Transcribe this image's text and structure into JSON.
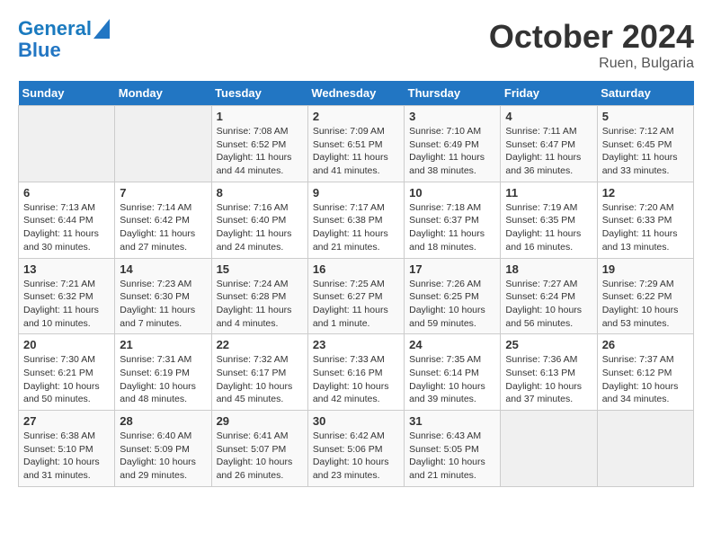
{
  "header": {
    "logo_line1": "General",
    "logo_line2": "Blue",
    "month": "October 2024",
    "location": "Ruen, Bulgaria"
  },
  "weekdays": [
    "Sunday",
    "Monday",
    "Tuesday",
    "Wednesday",
    "Thursday",
    "Friday",
    "Saturday"
  ],
  "weeks": [
    [
      {
        "day": "",
        "info": ""
      },
      {
        "day": "",
        "info": ""
      },
      {
        "day": "1",
        "info": "Sunrise: 7:08 AM\nSunset: 6:52 PM\nDaylight: 11 hours and 44 minutes."
      },
      {
        "day": "2",
        "info": "Sunrise: 7:09 AM\nSunset: 6:51 PM\nDaylight: 11 hours and 41 minutes."
      },
      {
        "day": "3",
        "info": "Sunrise: 7:10 AM\nSunset: 6:49 PM\nDaylight: 11 hours and 38 minutes."
      },
      {
        "day": "4",
        "info": "Sunrise: 7:11 AM\nSunset: 6:47 PM\nDaylight: 11 hours and 36 minutes."
      },
      {
        "day": "5",
        "info": "Sunrise: 7:12 AM\nSunset: 6:45 PM\nDaylight: 11 hours and 33 minutes."
      }
    ],
    [
      {
        "day": "6",
        "info": "Sunrise: 7:13 AM\nSunset: 6:44 PM\nDaylight: 11 hours and 30 minutes."
      },
      {
        "day": "7",
        "info": "Sunrise: 7:14 AM\nSunset: 6:42 PM\nDaylight: 11 hours and 27 minutes."
      },
      {
        "day": "8",
        "info": "Sunrise: 7:16 AM\nSunset: 6:40 PM\nDaylight: 11 hours and 24 minutes."
      },
      {
        "day": "9",
        "info": "Sunrise: 7:17 AM\nSunset: 6:38 PM\nDaylight: 11 hours and 21 minutes."
      },
      {
        "day": "10",
        "info": "Sunrise: 7:18 AM\nSunset: 6:37 PM\nDaylight: 11 hours and 18 minutes."
      },
      {
        "day": "11",
        "info": "Sunrise: 7:19 AM\nSunset: 6:35 PM\nDaylight: 11 hours and 16 minutes."
      },
      {
        "day": "12",
        "info": "Sunrise: 7:20 AM\nSunset: 6:33 PM\nDaylight: 11 hours and 13 minutes."
      }
    ],
    [
      {
        "day": "13",
        "info": "Sunrise: 7:21 AM\nSunset: 6:32 PM\nDaylight: 11 hours and 10 minutes."
      },
      {
        "day": "14",
        "info": "Sunrise: 7:23 AM\nSunset: 6:30 PM\nDaylight: 11 hours and 7 minutes."
      },
      {
        "day": "15",
        "info": "Sunrise: 7:24 AM\nSunset: 6:28 PM\nDaylight: 11 hours and 4 minutes."
      },
      {
        "day": "16",
        "info": "Sunrise: 7:25 AM\nSunset: 6:27 PM\nDaylight: 11 hours and 1 minute."
      },
      {
        "day": "17",
        "info": "Sunrise: 7:26 AM\nSunset: 6:25 PM\nDaylight: 10 hours and 59 minutes."
      },
      {
        "day": "18",
        "info": "Sunrise: 7:27 AM\nSunset: 6:24 PM\nDaylight: 10 hours and 56 minutes."
      },
      {
        "day": "19",
        "info": "Sunrise: 7:29 AM\nSunset: 6:22 PM\nDaylight: 10 hours and 53 minutes."
      }
    ],
    [
      {
        "day": "20",
        "info": "Sunrise: 7:30 AM\nSunset: 6:21 PM\nDaylight: 10 hours and 50 minutes."
      },
      {
        "day": "21",
        "info": "Sunrise: 7:31 AM\nSunset: 6:19 PM\nDaylight: 10 hours and 48 minutes."
      },
      {
        "day": "22",
        "info": "Sunrise: 7:32 AM\nSunset: 6:17 PM\nDaylight: 10 hours and 45 minutes."
      },
      {
        "day": "23",
        "info": "Sunrise: 7:33 AM\nSunset: 6:16 PM\nDaylight: 10 hours and 42 minutes."
      },
      {
        "day": "24",
        "info": "Sunrise: 7:35 AM\nSunset: 6:14 PM\nDaylight: 10 hours and 39 minutes."
      },
      {
        "day": "25",
        "info": "Sunrise: 7:36 AM\nSunset: 6:13 PM\nDaylight: 10 hours and 37 minutes."
      },
      {
        "day": "26",
        "info": "Sunrise: 7:37 AM\nSunset: 6:12 PM\nDaylight: 10 hours and 34 minutes."
      }
    ],
    [
      {
        "day": "27",
        "info": "Sunrise: 6:38 AM\nSunset: 5:10 PM\nDaylight: 10 hours and 31 minutes."
      },
      {
        "day": "28",
        "info": "Sunrise: 6:40 AM\nSunset: 5:09 PM\nDaylight: 10 hours and 29 minutes."
      },
      {
        "day": "29",
        "info": "Sunrise: 6:41 AM\nSunset: 5:07 PM\nDaylight: 10 hours and 26 minutes."
      },
      {
        "day": "30",
        "info": "Sunrise: 6:42 AM\nSunset: 5:06 PM\nDaylight: 10 hours and 23 minutes."
      },
      {
        "day": "31",
        "info": "Sunrise: 6:43 AM\nSunset: 5:05 PM\nDaylight: 10 hours and 21 minutes."
      },
      {
        "day": "",
        "info": ""
      },
      {
        "day": "",
        "info": ""
      }
    ]
  ]
}
